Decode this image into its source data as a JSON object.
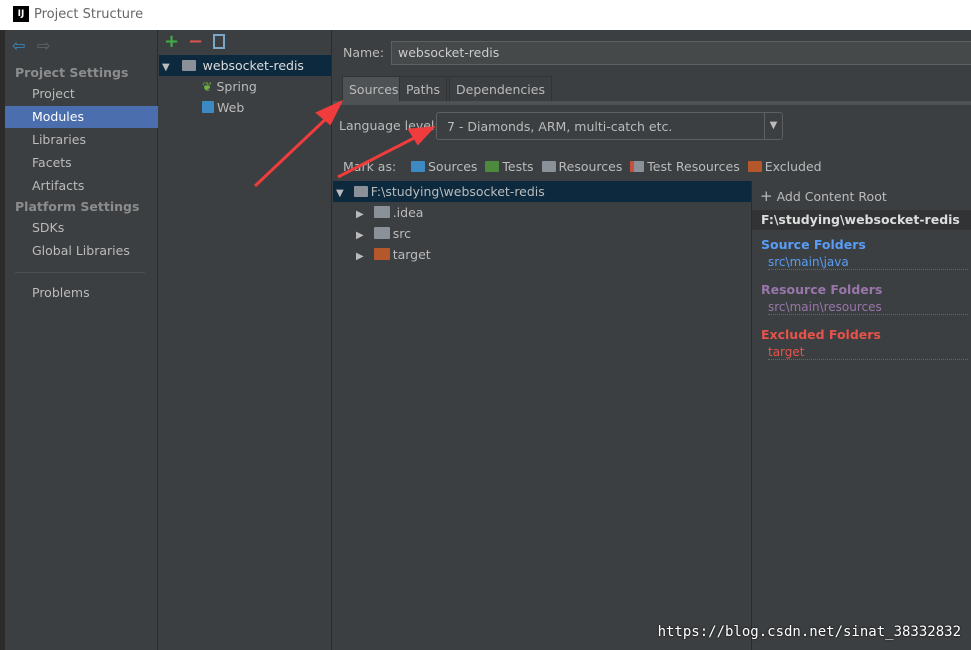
{
  "window": {
    "title": "Project Structure",
    "logo": "IJ"
  },
  "nav": {
    "back": "arrow-left-icon",
    "forward": "arrow-right-icon",
    "project_settings": "Project Settings",
    "project_items": [
      "Project",
      "Modules",
      "Libraries",
      "Facets",
      "Artifacts"
    ],
    "selected": "Modules",
    "platform_settings": "Platform Settings",
    "platform_items": [
      "SDKs",
      "Global Libraries"
    ],
    "problems": "Problems"
  },
  "modules": {
    "add": "+",
    "remove": "−",
    "root": "websocket-redis",
    "children": [
      "Spring",
      "Web"
    ]
  },
  "main": {
    "name_label": "Name:",
    "name_value": "websocket-redis",
    "tabs": [
      "Sources",
      "Paths",
      "Dependencies"
    ],
    "language_label": "Language level:",
    "language_value": "7 - Diamonds, ARM, multi-catch etc.",
    "mark_as": "Mark as:",
    "marks": [
      "Sources",
      "Tests",
      "Resources",
      "Test Resources",
      "Excluded"
    ],
    "colors": {
      "sources": "#3d8ac2",
      "tests": "#4e8a3e",
      "resources": "#8a9199",
      "excluded": "#b4572a"
    },
    "tree": {
      "root": "F:\\studying\\websocket-redis",
      "children": [
        ".idea",
        "src",
        "target"
      ]
    },
    "right": {
      "add_root": "Add Content Root",
      "path": "F:\\studying\\websocket-redis",
      "source_folders": "Source Folders",
      "source_path": "src\\main\\java",
      "resource_folders": "Resource Folders",
      "resource_path": "src\\main\\resources",
      "excluded_folders": "Excluded Folders",
      "excluded_path": "target"
    }
  },
  "watermark": "https://blog.csdn.net/sinat_38332832"
}
